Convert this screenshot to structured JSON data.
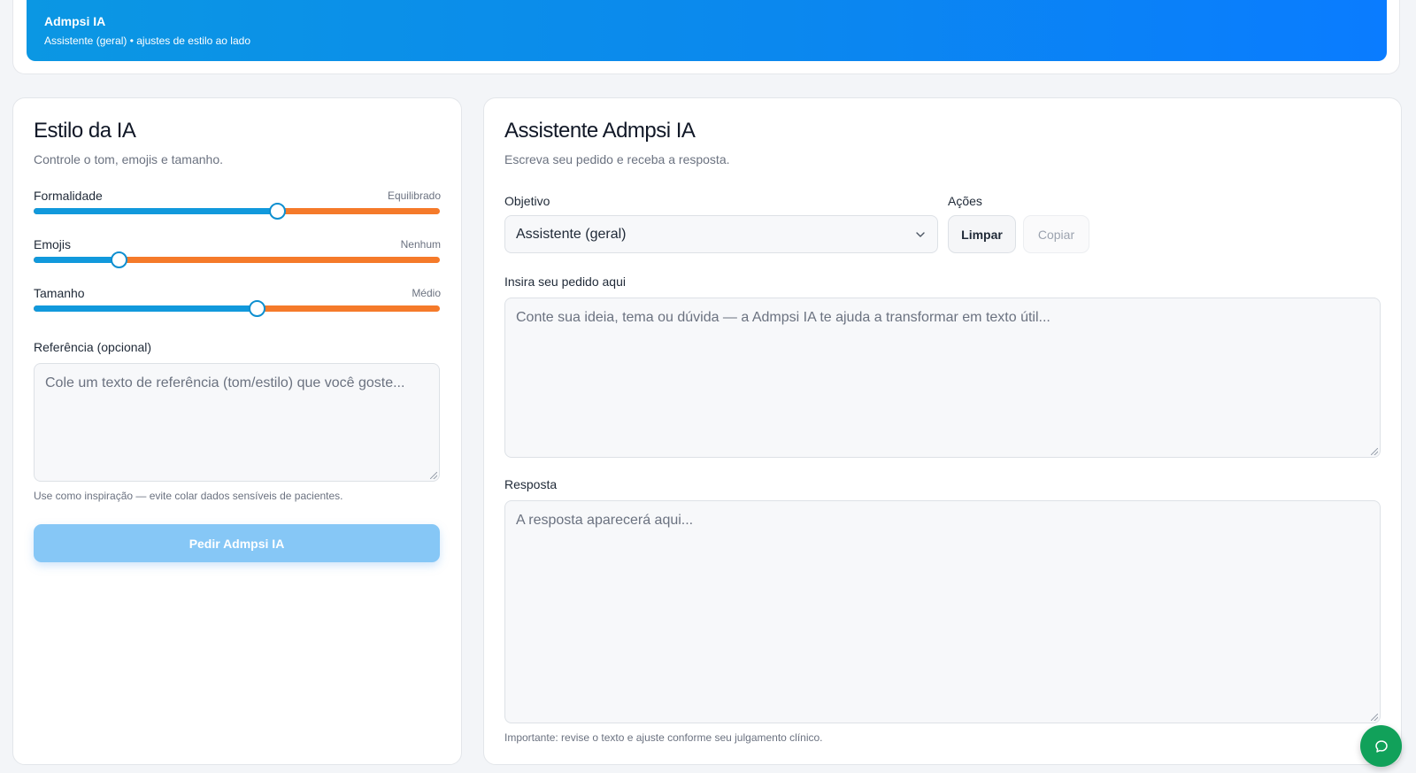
{
  "header": {
    "title": "Admpsi IA",
    "subtitle": "Assistente (geral) • ajustes de estilo ao lado"
  },
  "style_panel": {
    "title": "Estilo da IA",
    "subtitle": "Controle o tom, emojis e tamanho.",
    "sliders": [
      {
        "label": "Formalidade",
        "value_label": "Equilibrado",
        "level": 0.6
      },
      {
        "label": "Emojis",
        "value_label": "Nenhum",
        "level": 0.21
      },
      {
        "label": "Tamanho",
        "value_label": "Médio",
        "level": 0.55
      }
    ],
    "reference_label": "Referência (opcional)",
    "reference_placeholder": "Cole um texto de referência (tom/estilo) que você goste...",
    "reference_hint": "Use como inspiração — evite colar dados sensíveis de pacientes.",
    "submit_label": "Pedir Admpsi IA"
  },
  "assistant_panel": {
    "title": "Assistente Admpsi IA",
    "subtitle": "Escreva seu pedido e receba a resposta.",
    "objective_label": "Objetivo",
    "objective_selected": "Assistente (geral)",
    "actions_label": "Ações",
    "clear_label": "Limpar",
    "copy_label": "Copiar",
    "request_label": "Insira seu pedido aqui",
    "request_placeholder": "Conte sua ideia, tema ou dúvida — a Admpsi IA te ajuda a transformar em texto útil...",
    "response_label": "Resposta",
    "response_placeholder": "A resposta aparecerá aqui...",
    "footer_note": "Importante: revise o texto e ajuste conforme seu julgamento clínico."
  },
  "colors": {
    "header_gradient_start": "#0b97e3",
    "header_gradient_end": "#0a7cff",
    "slider_fill": "#1199dc",
    "slider_rest": "#f57a2a",
    "primary_button": "#86c7f6",
    "chat_fab": "#11a15a"
  },
  "icons": {
    "select_chevron": "chevron-down-icon",
    "chat": "chat-bubble-icon"
  }
}
